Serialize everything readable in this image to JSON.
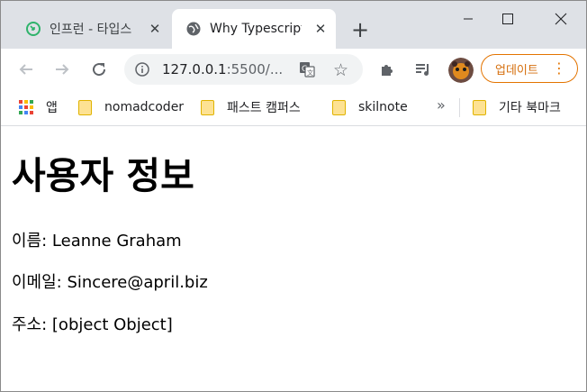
{
  "tabs": [
    {
      "title": "인프런 - 타입스",
      "favicon": "inflearn-icon",
      "active": false
    },
    {
      "title": "Why Typescript",
      "favicon": "globe-icon",
      "active": true
    }
  ],
  "toolbar": {
    "url_host": "127.0.0.1",
    "url_rest": ":5500/...",
    "update_label": "업데이트"
  },
  "bookmarks": {
    "apps_label": "앱",
    "items": [
      "nomadcoder",
      "패스트 캠퍼스",
      "skilnote"
    ],
    "other_label": "기타 북마크"
  },
  "page": {
    "heading": "사용자 정보",
    "lines": [
      "이름: Leanne Graham",
      "이메일: Sincere@april.biz",
      "주소: [object Object]"
    ]
  },
  "colors": {
    "tabstrip": "#dee1e6",
    "accent_update": "#e37400",
    "folder": "#fde293"
  }
}
